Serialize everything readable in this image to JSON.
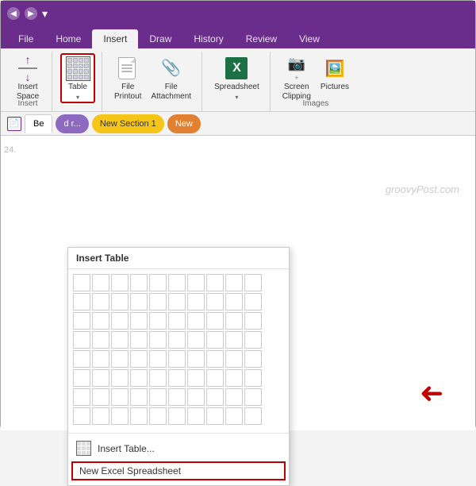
{
  "titleBar": {
    "backLabel": "◀",
    "forwardLabel": "▶",
    "dropdownLabel": "▾"
  },
  "tabs": {
    "items": [
      "File",
      "Home",
      "Insert",
      "Draw",
      "History",
      "Review",
      "View"
    ],
    "active": "Insert"
  },
  "ribbon": {
    "groups": [
      {
        "label": "Insert",
        "buttons": [
          {
            "id": "insert-space",
            "label": "Insert\nSpace",
            "icon": "insert-space"
          }
        ]
      },
      {
        "label": "",
        "buttons": [
          {
            "id": "table",
            "label": "Table",
            "icon": "table",
            "selected": true,
            "hasDropdown": true
          }
        ]
      },
      {
        "label": "",
        "buttons": [
          {
            "id": "file-printout",
            "label": "File\nPrintout",
            "icon": "file"
          },
          {
            "id": "file-attachment",
            "label": "File\nAttachment",
            "icon": "paperclip"
          }
        ]
      },
      {
        "label": "",
        "buttons": [
          {
            "id": "spreadsheet",
            "label": "Spreadsheet",
            "icon": "excel",
            "hasDropdown": true
          }
        ]
      },
      {
        "label": "Images",
        "buttons": [
          {
            "id": "screen-clipping",
            "label": "Screen\nClipping",
            "icon": "camera"
          },
          {
            "id": "pictures",
            "label": "Pictures",
            "icon": "pictures"
          }
        ]
      }
    ]
  },
  "pageTabs": {
    "items": [
      {
        "label": "Be",
        "type": "active"
      },
      {
        "label": "d r...",
        "type": "purple"
      },
      {
        "label": "New Section 1",
        "type": "yellow"
      },
      {
        "label": "New",
        "type": "orange"
      }
    ]
  },
  "page": {
    "lineNumber": "24.",
    "watermark": "groovyPost.com"
  },
  "dropdown": {
    "header": "Insert Table",
    "gridRows": 8,
    "gridCols": 10,
    "insertTableLabel": "Insert Table...",
    "newExcelLabel": "New Excel Spreadsheet"
  },
  "arrowIndicator": "➜"
}
